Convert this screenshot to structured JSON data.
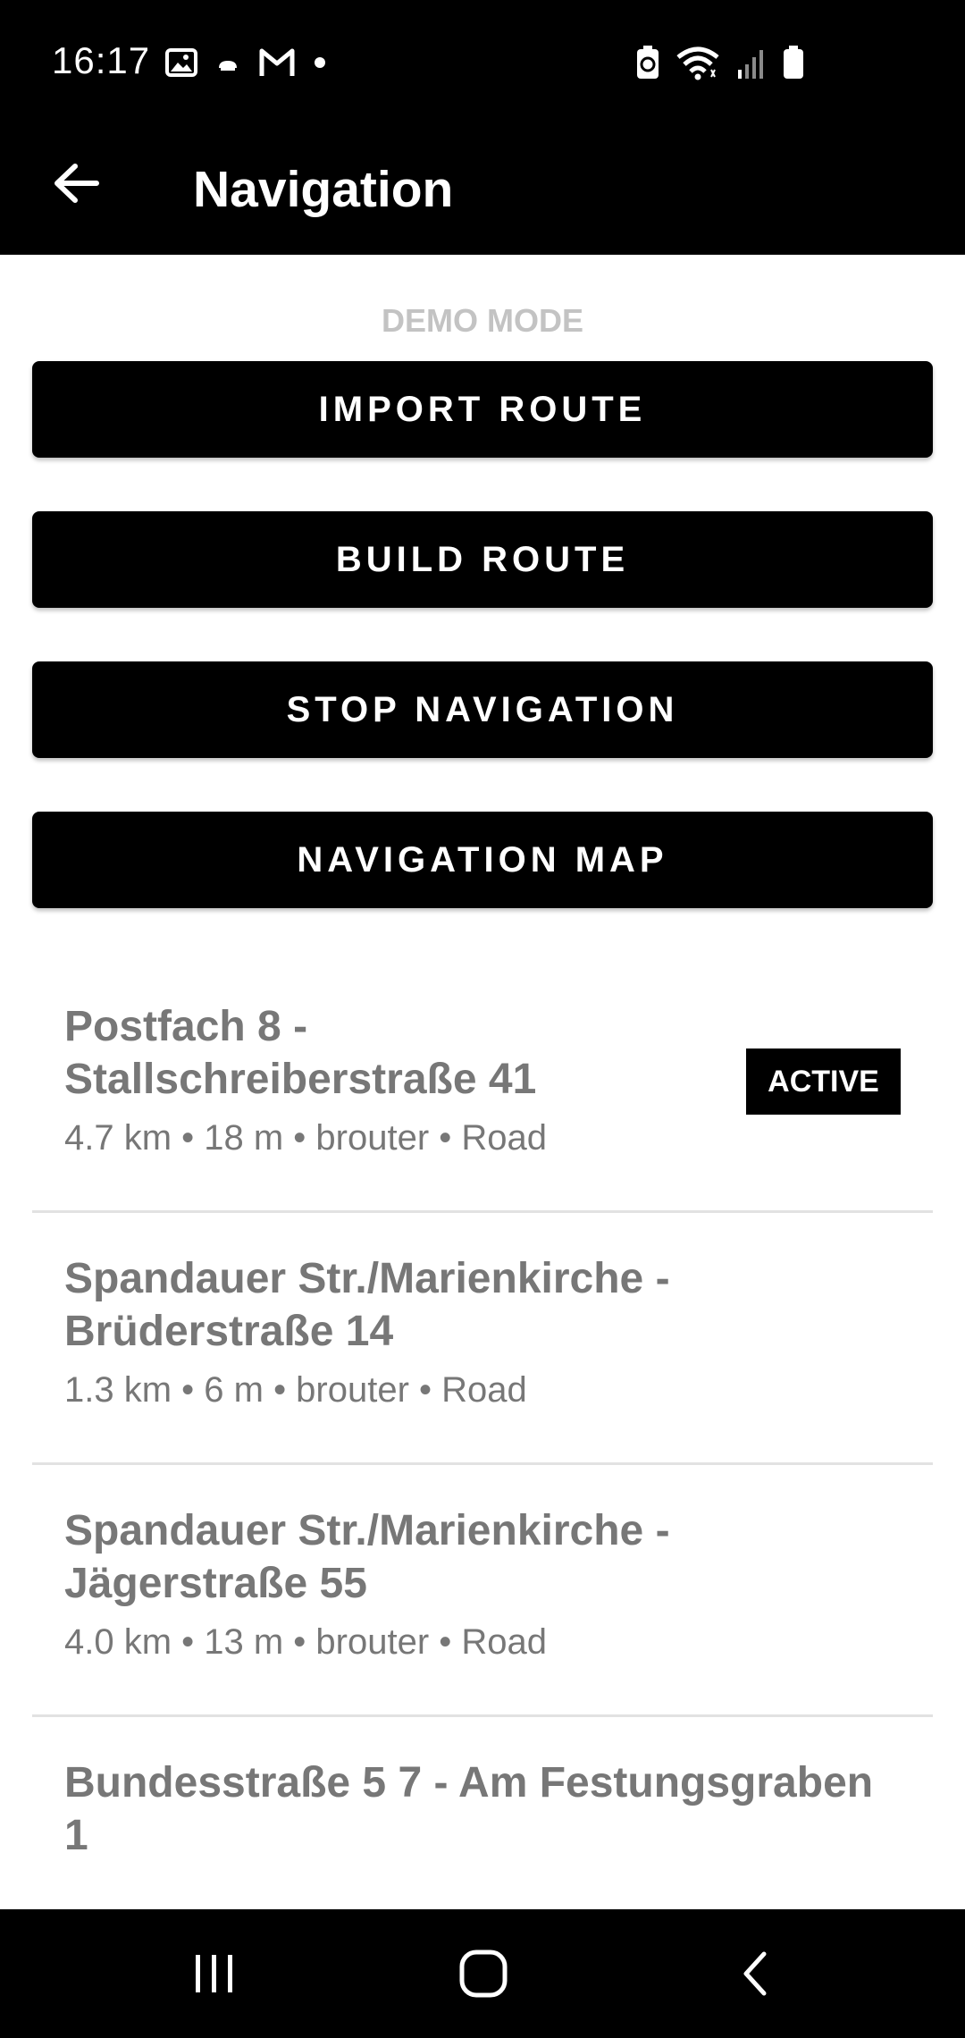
{
  "status_bar": {
    "time": "16:17",
    "left_icons": [
      "image-icon",
      "cloud-icon",
      "gmail-icon",
      "dot-icon"
    ],
    "right_icons": [
      "battery-saver-icon",
      "wifi-icon",
      "signal-icon",
      "battery-icon"
    ]
  },
  "app_bar": {
    "title": "Navigation",
    "back_icon": "arrow-left-icon"
  },
  "main": {
    "demo_mode_label": "DEMO MODE",
    "buttons": {
      "import_route": "IMPORT ROUTE",
      "build_route": "BUILD ROUTE",
      "stop_navigation": "STOP NAVIGATION",
      "navigation_map": "NAVIGATION MAP"
    },
    "routes": [
      {
        "title": "Postfach 8 - Stallschreiberstraße 41",
        "meta": "4.7 km • 18 m • brouter • Road",
        "badge": "ACTIVE"
      },
      {
        "title": "Spandauer Str./Marienkirche - Brüderstraße 14",
        "meta": "1.3 km • 6 m • brouter • Road"
      },
      {
        "title": "Spandauer Str./Marienkirche - Jägerstraße 55",
        "meta": "4.0 km • 13 m • brouter • Road"
      },
      {
        "title": "Bundesstraße 5 7 - Am Festungsgraben 1"
      }
    ]
  },
  "nav_bar": {
    "icons": [
      "recents-icon",
      "home-icon",
      "back-icon"
    ]
  },
  "colors": {
    "bars": "#000000",
    "list_text": "#777777",
    "demo_mode": "#c3c3c3",
    "divider": "#e2e2e2"
  }
}
